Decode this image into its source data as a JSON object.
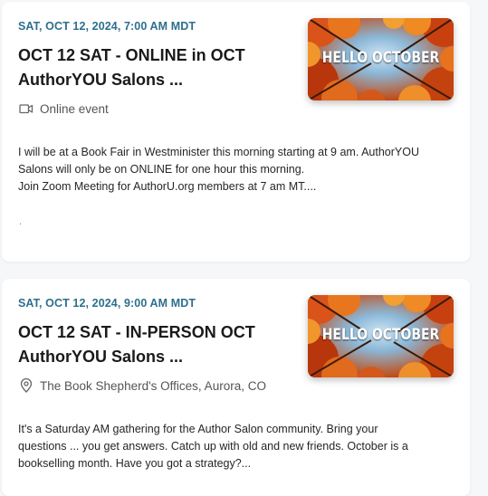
{
  "events": [
    {
      "date": "SAT, OCT 12, 2024, 7:00 AM MDT",
      "title_line1": "OCT 12 SAT - ONLINE in OCT",
      "title_line2": "AuthorYOU Salons ...",
      "image_text": "HELLO OCTOBER",
      "location_icon": "video-camera-icon",
      "location": "Online event",
      "description": [
        "I will be at a Book Fair in Westminister this morning starting at 9 am. AuthorYOU",
        "Salons will only be on ONLINE for one hour this morning.",
        "Join Zoom Meeting for AuthorU.org members at 7 am MT...."
      ],
      "trailing": "."
    },
    {
      "date": "SAT, OCT 12, 2024, 9:00 AM MDT",
      "title_line1": "OCT 12 SAT - IN-PERSON OCT",
      "title_line2": "AuthorYOU Salons ...",
      "image_text": "HELLO OCTOBER",
      "location_icon": "map-pin-icon",
      "location": "The Book Shepherd's Offices, Aurora, CO",
      "description": [
        "It's a Saturday AM gathering for the Author Salon community. Bring your",
        "questions ... you get answers. Catch up with old and new friends. October is a",
        "bookselling month. Have you got a strategy?..."
      ]
    }
  ],
  "colors": {
    "date": "#2d6f8c",
    "background": "#f6f7f8",
    "card": "#ffffff"
  }
}
